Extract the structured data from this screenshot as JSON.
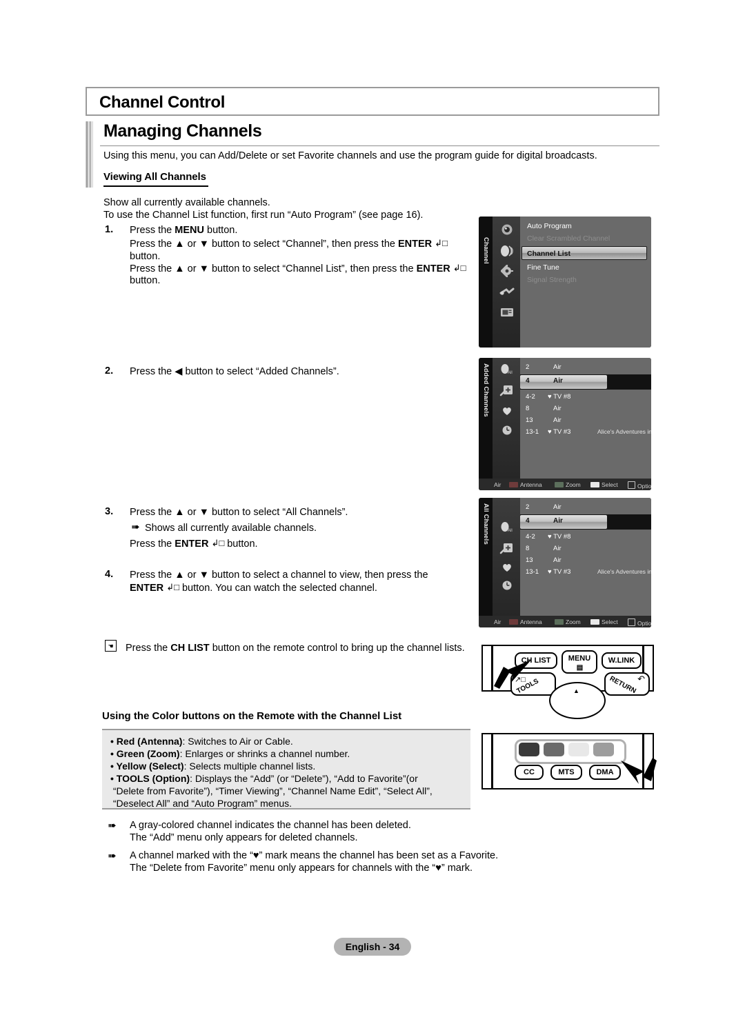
{
  "header": {
    "chapter_title": "Channel Control",
    "section_title": "Managing Channels",
    "intro": "Using this menu, you can Add/Delete or set Favorite channels and use the program guide for digital broadcasts.",
    "subhead": "Viewing All Channels"
  },
  "lead": {
    "line1": "Show all currently available channels.",
    "line2": "To use the Channel List function, first run “Auto Program” (see page 16)."
  },
  "steps": [
    {
      "number": "1.",
      "lines": [
        "Press the MENU button.",
        "Press the ▲ or ▼ button to select “Channel”, then press the ENTER ⏎",
        "button.",
        "Press the ▲ or ▼ button to select “Channel List”, then press the ENTER ⏎",
        "button."
      ]
    },
    {
      "number": "2.",
      "lines": [
        "Press the ◀ button to select “Added Channels”."
      ]
    },
    {
      "number": "3.",
      "lines": [
        "Press the ▲ or ▼ button to select “All Channels”.",
        "Shows all currently available channels.",
        "Press the ENTER ⏎ button."
      ]
    },
    {
      "number": "4.",
      "lines": [
        "Press the ▲ or ▼ button to select a channel to view, then press the",
        "ENTER ⏎ button. You can watch the selected channel."
      ]
    }
  ],
  "ch_list_hint": {
    "icon": "hand-pointer-icon",
    "text": "Press the CH LIST button on the remote control to bring up the channel lists."
  },
  "osd_menu": {
    "tab_label": "Channel",
    "items": [
      {
        "label": "Auto Program",
        "state": "normal"
      },
      {
        "label": "Clear Scrambled Channel",
        "state": "disabled"
      },
      {
        "label": "Channel List",
        "state": "highlighted"
      },
      {
        "label": "Fine Tune",
        "state": "normal"
      },
      {
        "label": "Signal Strength",
        "state": "disabled"
      }
    ],
    "sidebar_icons": [
      "picture-icon",
      "sound-icon",
      "setup-icon",
      "input-icon",
      "support-icon"
    ]
  },
  "osd_added": {
    "tab_label": "Added Channels",
    "sidebar_icons": [
      "all-channels-icon",
      "added-channels-icon",
      "favorite-heart-icon",
      "programmed-clock-icon"
    ],
    "rows": [
      {
        "num": "2",
        "name": "Air",
        "fav": "",
        "title": ""
      },
      {
        "num": "4",
        "name": "Air",
        "fav": "",
        "title": "",
        "selected": true
      },
      {
        "num": "4-2",
        "name": "TV #8",
        "fav": "♥",
        "title": ""
      },
      {
        "num": "8",
        "name": "Air",
        "fav": "",
        "title": ""
      },
      {
        "num": "13",
        "name": "Air",
        "fav": "",
        "title": ""
      },
      {
        "num": "13-1",
        "name": "TV #3",
        "fav": "♥",
        "title": "Alice's Adventures in Wonderland"
      }
    ],
    "footer": {
      "mode": "Air",
      "buttons": [
        {
          "label": "Antenna",
          "color": "#6e3b3b"
        },
        {
          "label": "Zoom",
          "color": "#5c6f5c"
        },
        {
          "label": "Select",
          "color": "#e8e8e8"
        },
        {
          "label": "Option",
          "color": ""
        }
      ]
    }
  },
  "osd_all": {
    "tab_label": "All Channels",
    "sidebar_icons": [
      "all-channels-icon",
      "added-channels-icon",
      "favorite-heart-icon",
      "programmed-clock-icon"
    ],
    "rows": [
      {
        "num": "2",
        "name": "Air",
        "fav": "",
        "title": ""
      },
      {
        "num": "4",
        "name": "Air",
        "fav": "",
        "title": "",
        "selected": true
      },
      {
        "num": "4-2",
        "name": "TV #8",
        "fav": "♥",
        "title": ""
      },
      {
        "num": "8",
        "name": "Air",
        "fav": "",
        "title": ""
      },
      {
        "num": "13",
        "name": "Air",
        "fav": "",
        "title": ""
      },
      {
        "num": "13-1",
        "name": "TV #3",
        "fav": "♥",
        "title": "Alice's Adventures in Wonderland"
      }
    ],
    "footer": {
      "mode": "Air",
      "buttons": [
        {
          "label": "Antenna",
          "color": "#6e3b3b"
        },
        {
          "label": "Zoom",
          "color": "#5c6f5c"
        },
        {
          "label": "Select",
          "color": "#e8e8e8"
        },
        {
          "label": "Option",
          "color": ""
        }
      ]
    }
  },
  "remote_top": {
    "keys": [
      {
        "label": "CH LIST"
      },
      {
        "label": "MENU"
      },
      {
        "label": "W.LINK"
      },
      {
        "label": "TOOLS"
      },
      {
        "label": "RETURN"
      }
    ]
  },
  "remote_bottom": {
    "color_keys": [
      {
        "name": "red-color-button",
        "color": "#3a3a3a"
      },
      {
        "name": "green-color-button",
        "color": "#6b6b6b"
      },
      {
        "name": "yellow-color-button",
        "color": "#e8e8e8"
      },
      {
        "name": "blue-color-button",
        "color": "#9d9d9d"
      }
    ],
    "keys": [
      {
        "label": "CC"
      },
      {
        "label": "MTS"
      },
      {
        "label": "DMA"
      }
    ]
  },
  "color_buttons_section": {
    "heading": "Using the Color buttons on the Remote with the Channel List",
    "items": [
      {
        "bold": "• Red (Antenna)",
        "rest": ": Switches to Air or Cable."
      },
      {
        "bold": "• Green (Zoom)",
        "rest": ": Enlarges or shrinks a channel number."
      },
      {
        "bold": "• Yellow (Select)",
        "rest": ": Selects multiple channel lists."
      },
      {
        "bold": "• TOOLS (Option)",
        "rest": ": Displays the “Add” (or “Delete”), “Add to Favorite”(or"
      },
      {
        "bold": "",
        "rest": " “Delete from Favorite”), “Timer Viewing”, “Channel Name Edit”, “Select All”,"
      },
      {
        "bold": "",
        "rest": " “Deselect All” and “Auto Program” menus."
      }
    ]
  },
  "notes": [
    {
      "line1": "A gray-colored channel indicates the channel has been deleted.",
      "line2": "The “Add” menu only appears for deleted channels."
    },
    {
      "line1": "A channel marked with the “♥” mark means the channel has been set as a Favorite.",
      "line2": "The “Delete from Favorite” menu only appears for channels with the “♥” mark."
    }
  ],
  "footer": {
    "page_label": "English - 34"
  }
}
